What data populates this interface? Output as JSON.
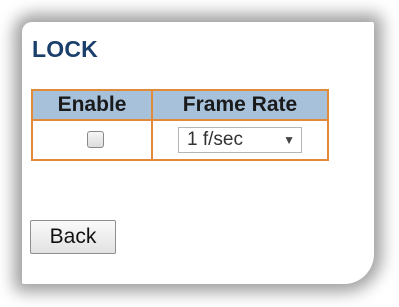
{
  "page": {
    "title": "LOCK"
  },
  "table": {
    "headers": {
      "enable": "Enable",
      "frame_rate": "Frame Rate"
    },
    "row": {
      "enable_checked": false,
      "frame_rate_value": "1 f/sec"
    }
  },
  "buttons": {
    "back_label": "Back"
  },
  "colors": {
    "title": "#1b3f6b",
    "header_bg": "#a7c1db",
    "table_border": "#e08a3a"
  },
  "icons": {
    "dropdown": "chevron-down-icon"
  }
}
